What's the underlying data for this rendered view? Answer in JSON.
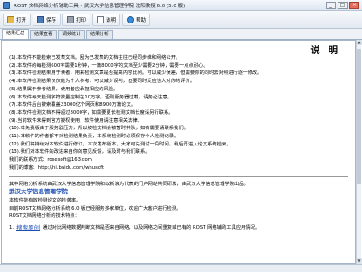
{
  "window": {
    "title": "ROST 文档网络分析辅助工具 – 武汉大学信息管理学院 沈阳教授 6.0 (5.0 版)",
    "minimize": "_",
    "maximize": "□",
    "close": "×"
  },
  "toolbar": {
    "buttons": [
      {
        "label": "打开",
        "icon": "open-icon"
      },
      {
        "label": "保存",
        "icon": "save-icon"
      },
      {
        "label": "打印",
        "icon": "print-icon"
      },
      {
        "label": "说明",
        "icon": "document-icon"
      },
      {
        "label": "帮助",
        "icon": "help-icon"
      }
    ]
  },
  "tabs": [
    "结果汇总",
    "结果查看",
    "词频统计",
    "结果分析"
  ],
  "doc": {
    "heading": "说 明",
    "paragraphs": [
      "(1).本软件不能检索已发表文档。因为已发表的文档往往已经同步维和网络公开。",
      "(2).本软件的每检测600字需要1秒钟，一篇8000字的文档至少需要2分钟，需要一点点耐心。",
      "(3).本软件检测结果用于读者，用来检测文章是否提高内容比例。可以减少误差，但需要你的同时去对照进行逐一修改。",
      "(4).本软件检测结果仅仅能为个人参考，可以减少误判，但要同时反应他人对你的评价。",
      "(5).结果属于参考结果，使用者应承担相应的风险。",
      "(6).本软件每天检测字符数量控制在10万字，否则服务器过载，请务必注意。",
      "(7).本软件后台搜索覆盖23000亿个网页和8900万篇论文。",
      "(8).本软件检测文档不得超过8000字，如需要更长检测文档长度请另行联系。",
      "(9).当前软件未得到官方授权使用，软件使用请注意相关法律。",
      "(10).本免费版由于服务器压力，所以被检文档会被暂时排队，如有需要请联系我们。",
      "(11).本软件的作者都不对检测结果负责，本系统检测时必须保存个人检测记录。",
      "(12).我们将持续对本软件进行修订，本次发布版本，大家可先测试一段时间，稍后再进入论文系统检索。",
      "(13).我们对本软件的改进来自你的意见反馈，请及时与我们联系。",
      "我们的联系方式：rosesoft@163.com",
      "我们的博客：http://hi.baidu.com/whusoft"
    ],
    "intro": [
      "其中网络分析系统由武汉大学信息管理学院和以新浪为代表的门户网站共同研发，由武汉大学信息管理学院出品。",
      "本软件能有效检测论文的抄袭率。",
      "目前ROST文档网络分析系统 6.0 版已经服务多家单位，欢迎广大客户进行检测。",
      "ROST文档网络分析的技术特点："
    ],
    "intro_highlight": "武汉大学信息管理学院",
    "link_number": "1.",
    "link_text": "搜索原创",
    "link_tail": "通过对比网络数据判断文档是否来自网络，以及网络之间重复或已有的 ROST 网络辅助工具应用情况。"
  },
  "statusbar": ""
}
